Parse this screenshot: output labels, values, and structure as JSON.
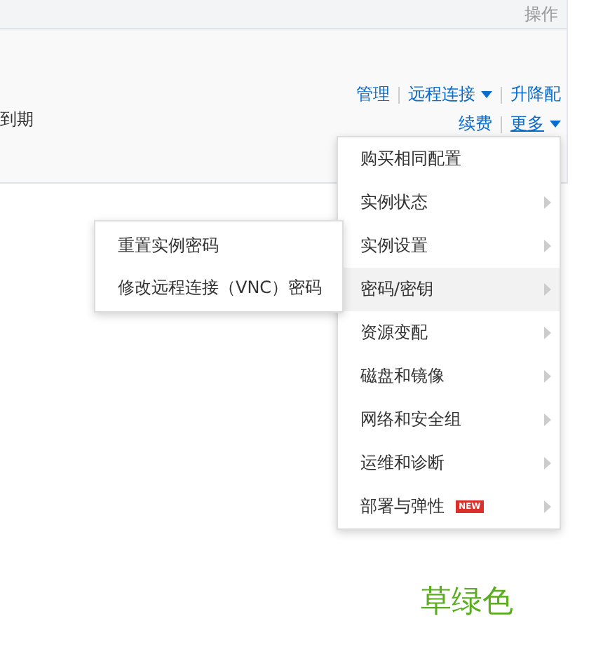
{
  "table": {
    "action_header": "操作",
    "row": {
      "expiry": "到期",
      "action_lines": [
        [
          {
            "label": "管理",
            "dropdown": false,
            "open": false
          },
          {
            "label": "远程连接",
            "dropdown": true,
            "open": false
          },
          {
            "label": "升降配",
            "dropdown": false,
            "open": false
          }
        ],
        [
          {
            "label": "续费",
            "dropdown": false,
            "open": false
          },
          {
            "label": "更多",
            "dropdown": true,
            "open": true
          }
        ]
      ]
    }
  },
  "more_menu": {
    "items": [
      {
        "label": "购买相同配置",
        "has_submenu": false,
        "selected": false
      },
      {
        "label": "实例状态",
        "has_submenu": true,
        "selected": false
      },
      {
        "label": "实例设置",
        "has_submenu": true,
        "selected": false
      },
      {
        "label": "密码/密钥",
        "has_submenu": true,
        "selected": true
      },
      {
        "label": "资源变配",
        "has_submenu": true,
        "selected": false
      },
      {
        "label": "磁盘和镜像",
        "has_submenu": true,
        "selected": false
      },
      {
        "label": "网络和安全组",
        "has_submenu": true,
        "selected": false
      },
      {
        "label": "运维和诊断",
        "has_submenu": true,
        "selected": false
      },
      {
        "label": "部署与弹性",
        "has_submenu": true,
        "selected": false,
        "badge": "NEW"
      }
    ]
  },
  "submenu": {
    "items": [
      {
        "label": "重置实例密码"
      },
      {
        "label": "修改远程连接（VNC）密码"
      }
    ]
  },
  "caption": "草绿色"
}
